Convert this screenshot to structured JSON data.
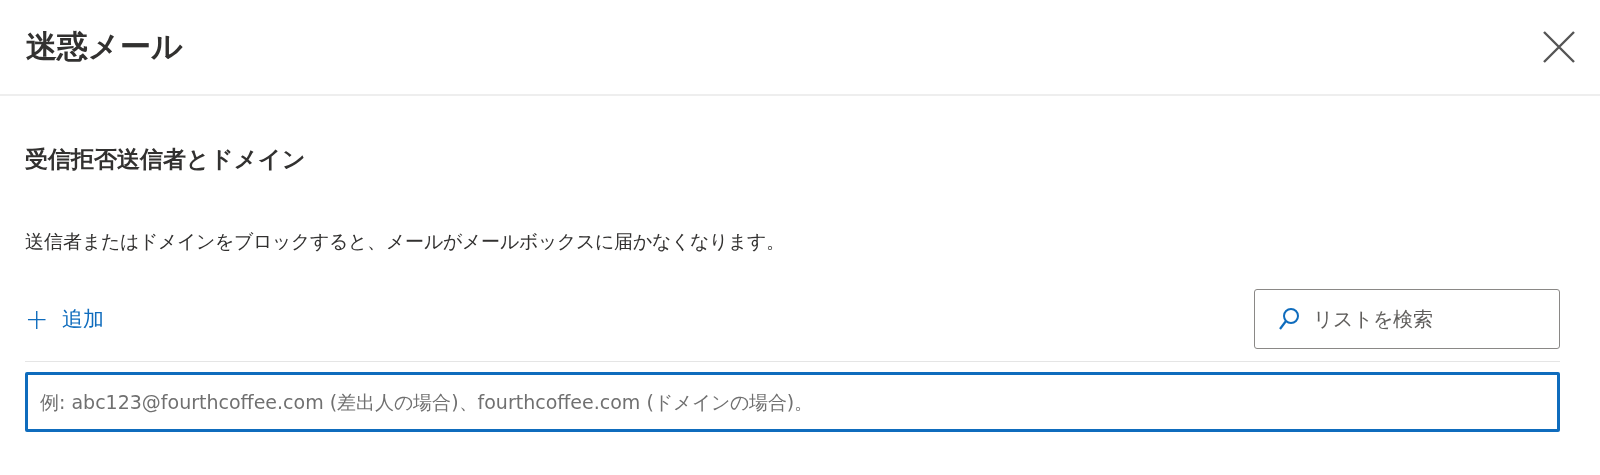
{
  "panel": {
    "title": "迷惑メール"
  },
  "section": {
    "heading": "受信拒否送信者とドメイン",
    "description": "送信者またはドメインをブロックすると、メールがメールボックスに届かなくなります。"
  },
  "add_button": {
    "icon": "+",
    "label": "追加"
  },
  "search": {
    "placeholder": "リストを検索"
  },
  "entry": {
    "placeholder": "例: abc123@fourthcoffee.com (差出人の場合)、fourthcoffee.com (ドメインの場合)。",
    "focused": true
  }
}
